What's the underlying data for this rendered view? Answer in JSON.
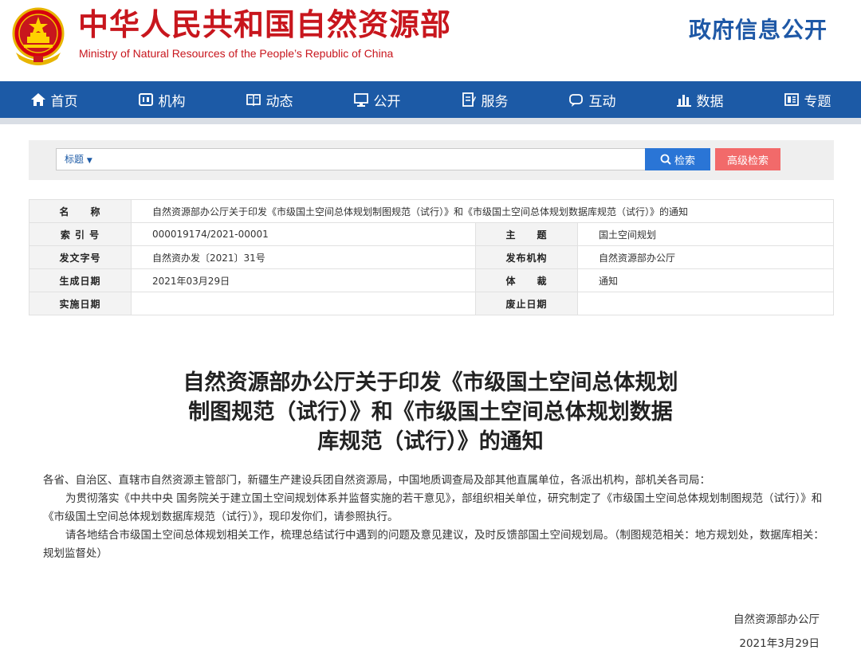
{
  "header": {
    "ministry_cn": "中华人民共和国自然资源部",
    "ministry_en": "Ministry of Natural Resources of the People’s Republic of China",
    "gov_info": "政府信息公开"
  },
  "nav": [
    {
      "label": "首页",
      "icon": "home-icon"
    },
    {
      "label": "机构",
      "icon": "org-icon"
    },
    {
      "label": "动态",
      "icon": "news-icon"
    },
    {
      "label": "公开",
      "icon": "monitor-icon"
    },
    {
      "label": "服务",
      "icon": "service-icon"
    },
    {
      "label": "互动",
      "icon": "chat-icon"
    },
    {
      "label": "数据",
      "icon": "bar-chart-icon"
    },
    {
      "label": "专题",
      "icon": "topic-icon"
    }
  ],
  "search": {
    "scope_label": "标题",
    "search_button": "检索",
    "advanced_button": "高级检索"
  },
  "info": {
    "name_label": "名　　称",
    "name_value": "自然资源部办公厅关于印发《市级国土空间总体规划制图规范（试行）》和《市级国土空间总体规划数据库规范（试行）》的通知",
    "index_label": "索 引 号",
    "index_value": "000019174/2021-00001",
    "subject_label": "主　　题",
    "subject_value": "国土空间规划",
    "docno_label": "发文字号",
    "docno_value": "自然资办发〔2021〕31号",
    "issuer_label": "发布机构",
    "issuer_value": "自然资源部办公厅",
    "date_label": "生成日期",
    "date_value": "2021年03月29日",
    "genre_label": "体　　裁",
    "genre_value": "通知",
    "effective_label": "实施日期",
    "effective_value": "",
    "expire_label": "废止日期",
    "expire_value": ""
  },
  "article": {
    "title_line1": "自然资源部办公厅关于印发《市级国土空间总体规划",
    "title_line2": "制图规范（试行）》和《市级国土空间总体规划数据",
    "title_line3": "库规范（试行）》的通知",
    "salutation": "各省、自治区、直辖市自然资源主管部门，新疆生产建设兵团自然资源局，中国地质调查局及部其他直属单位，各派出机构，部机关各司局：",
    "para1": "为贯彻落实《中共中央 国务院关于建立国土空间规划体系并监督实施的若干意见》，部组织相关单位，研究制定了《市级国土空间总体规划制图规范（试行）》和《市级国土空间总体规划数据库规范（试行）》，现印发你们，请参照执行。",
    "para2": "请各地结合市级国土空间总体规划相关工作，梳理总结试行中遇到的问题及意见建议，及时反馈部国土空间规划局。（制图规范相关：地方规划处，数据库相关：规划监督处）",
    "sign_org": "自然资源部办公厅",
    "sign_date": "2021年3月29日"
  },
  "colors": {
    "brand_red": "#c8161d",
    "nav_blue": "#1c5aa6",
    "search_blue": "#2a75d6",
    "advanced_red": "#f26a6a"
  }
}
